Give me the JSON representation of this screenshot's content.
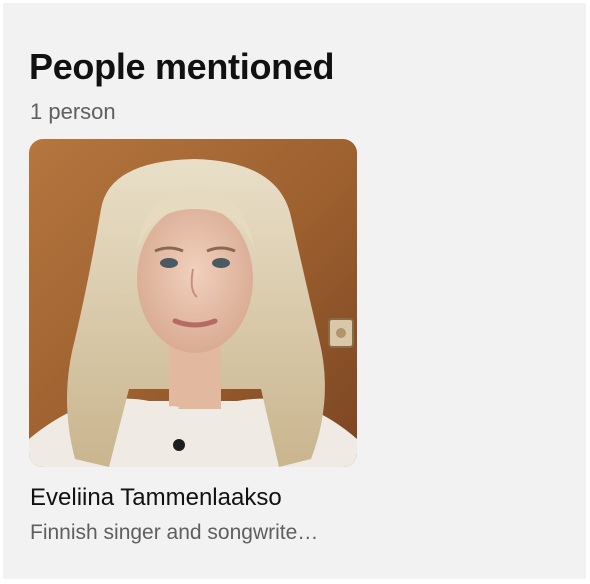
{
  "section": {
    "title": "People mentioned",
    "count_label": "1 person"
  },
  "people": [
    {
      "name": "Eveliina Tammenlaakso",
      "description": "Finnish singer and songwrite…",
      "photo_icon": "person-photo"
    }
  ],
  "colors": {
    "panel_background": "#f2f2f2",
    "title_text": "#111111",
    "secondary_text": "#5f5f5f"
  }
}
